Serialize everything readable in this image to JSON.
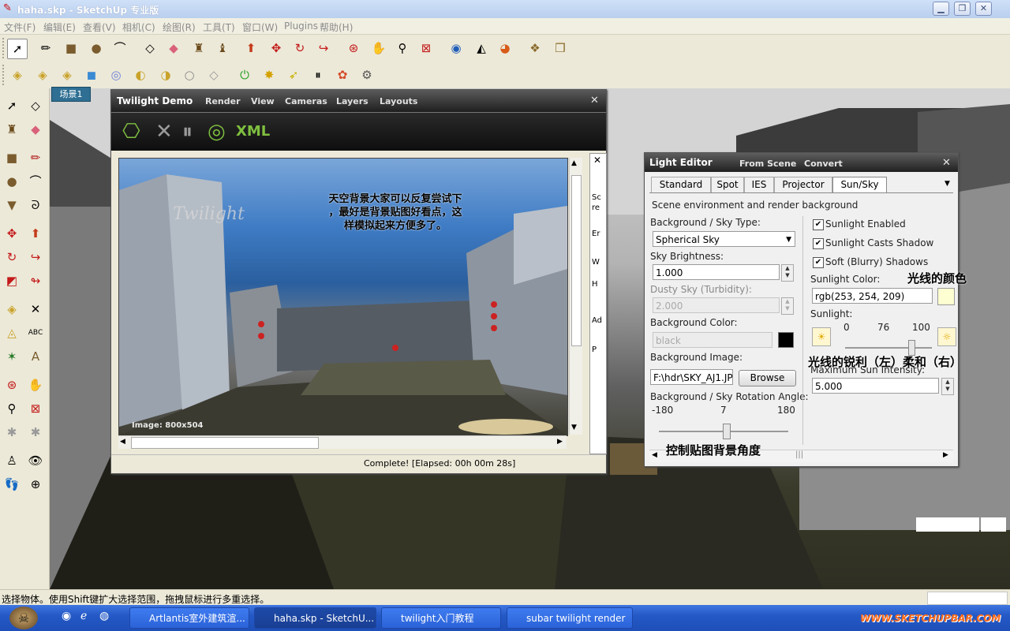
{
  "window": {
    "title": "haha.skp - SketchUp 专业版",
    "min": "0",
    "max": "1",
    "close": "r"
  },
  "menubar": [
    "文件(F)",
    "编辑(E)",
    "查看(V)",
    "相机(C)",
    "绘图(R)",
    "工具(T)",
    "窗口(W)",
    "Plugins",
    "帮助(H)"
  ],
  "toolbar1": [
    "select-icon",
    "pencil-icon",
    "rectangle-icon",
    "circle-icon",
    "arc-icon",
    "eraser-outline-icon",
    "eraser-icon",
    "paint-bucket-icon",
    "paint-icon",
    "push-pull-icon",
    "move-icon",
    "rotate-icon",
    "follow-me-icon",
    "orbit-icon",
    "pan-icon",
    "zoom-icon",
    "zoom-extents-icon",
    "get-models-icon",
    "share-icon",
    "geo-icon",
    "components-icon",
    "warehouse-icon"
  ],
  "toolbar2": [
    "tape-icon",
    "dimension-icon",
    "protractor-icon",
    "box-icon",
    "check-icon",
    "text-icon",
    "section-icon",
    "sphere-icon",
    "axes-icon",
    "power-icon",
    "sparkle-icon",
    "cursor-icon",
    "pause-icon",
    "palette-icon",
    "gear-icon"
  ],
  "scene_tab": "场景1",
  "twilight": {
    "title": "Twilight Demo",
    "menus": [
      "Render",
      "View",
      "Cameras",
      "Layers",
      "Layouts"
    ],
    "close": "✕",
    "watermark": "Twilight",
    "image_label": "Image: 800x504",
    "status": "Complete!  [Elapsed: 00h 00m 28s]",
    "side_close": "✕",
    "side_text": [
      "Sc",
      "re",
      "Er",
      "W",
      "H",
      "Ad",
      "P"
    ],
    "xml": "XML"
  },
  "annotations": {
    "sky": "天空背景大家可以反复尝试下，最好是背景贴图好看点，这样模拟起来方便多了。",
    "sky_lines": [
      "天空背景大家可以反复尝试下",
      "，最好是背景贴图好看点，这",
      "样模拟起来方便多了。"
    ],
    "sunlight_color": "光线的颜色",
    "sharpness": "光线的锐利（左）柔和（右）",
    "rotation": "控制贴图背景角度"
  },
  "light_editor": {
    "title": "Light Editor",
    "menus": [
      "From Scene",
      "Convert"
    ],
    "close": "✕",
    "tabs": [
      "Standard",
      "Spot",
      "IES",
      "Projector",
      "Sun/Sky"
    ],
    "active_tab": "Sun/Sky",
    "description": "Scene environment and render background",
    "bg_type_label": "Background / Sky Type:",
    "bg_type_value": "Spherical Sky",
    "sky_brightness_label": "Sky Brightness:",
    "sky_brightness_value": "1.000",
    "dusty_label": "Dusty Sky (Turbidity):",
    "dusty_value": "2.000",
    "bg_color_label": "Background Color:",
    "bg_color_value": "black",
    "bg_image_label": "Background Image:",
    "bg_image_value": "F:\\hdr\\SKY_AJ1.JP",
    "browse": "Browse",
    "rotation_label": "Background / Sky Rotation Angle:",
    "rotation_min": "-180",
    "rotation_value": "7",
    "rotation_max": "180",
    "rotation_fraction": 0.52,
    "sunlight_enabled": "Sunlight Enabled",
    "casts_shadow": "Sunlight Casts Shadow",
    "soft_shadows": "Soft (Blurry) Shadows",
    "sun_color_label": "Sunlight Color:",
    "sun_color_value": "rgb(253, 254, 209)",
    "sun_color_hex": "#fdfed1",
    "sunlight_label": "Sunlight:",
    "sun_min": "0",
    "sun_value": "76",
    "sun_max": "100",
    "sun_fraction": 0.76,
    "max_intensity_label": "Maximum Sun Intensity:",
    "max_intensity_value": "5.000"
  },
  "statusbar": "选择物体。使用Shift键扩大选择范围，拖拽鼠标进行多重选择。",
  "taskbar": {
    "items": [
      "Artlantis室外建筑渲...",
      "haha.skp - SketchU...",
      "twilight入门教程",
      "subar twilight  render"
    ],
    "active": 1,
    "watermark": "WWW.SKETCHUPBAR.COM"
  }
}
